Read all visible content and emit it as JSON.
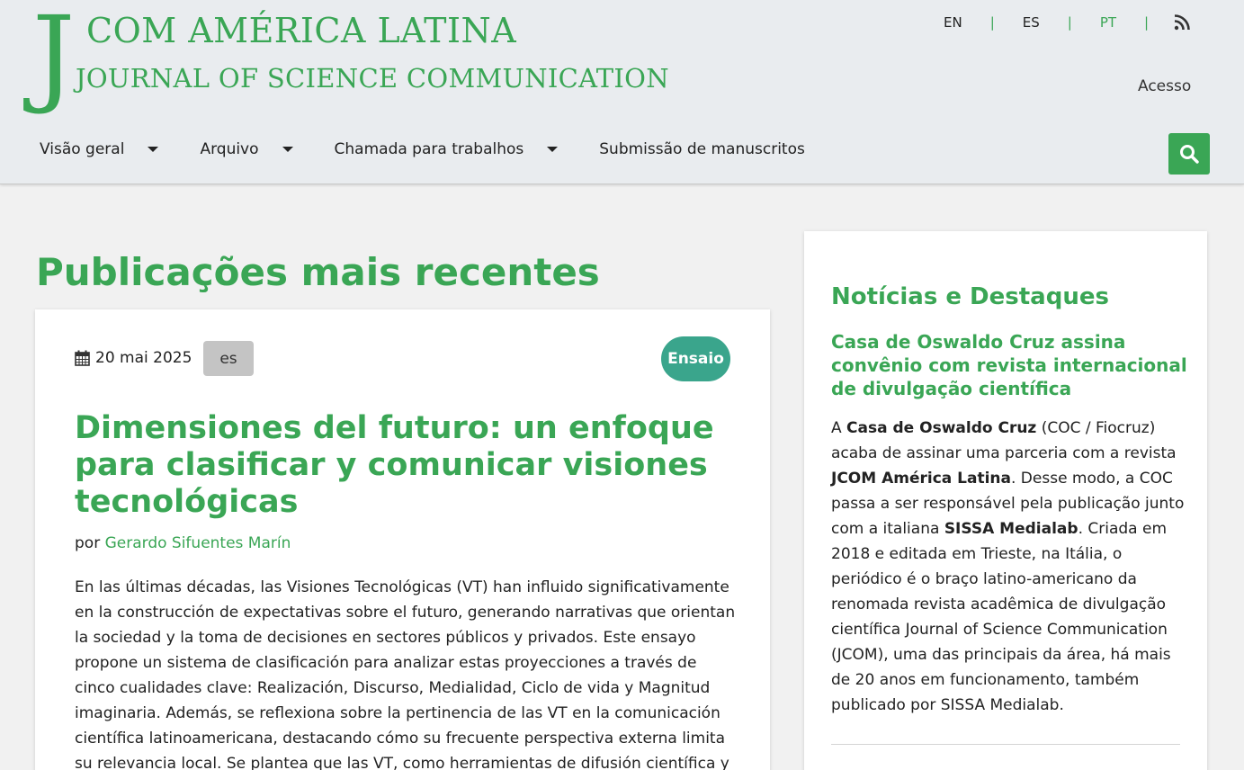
{
  "header": {
    "logo_j": "J",
    "logo_line1": "COM AMÉRICA LATINA",
    "logo_line2": "JOURNAL OF SCIENCE COMMUNICATION",
    "languages": [
      "EN",
      "ES",
      "PT"
    ],
    "active_language": "PT",
    "separator": "|",
    "rss_icon": "rss-icon",
    "login_label": "Acesso",
    "nav": [
      {
        "label": "Visão geral",
        "has_dropdown": true
      },
      {
        "label": "Arquivo",
        "has_dropdown": true
      },
      {
        "label": "Chamada para trabalhos",
        "has_dropdown": true
      },
      {
        "label": "Submissão de manuscritos",
        "has_dropdown": false
      }
    ],
    "search_icon": "search-icon"
  },
  "main": {
    "title": "Publicações mais recentes",
    "article": {
      "date": "20 mai 2025",
      "language": "es",
      "type": "Ensaio",
      "title": "Dimensiones del futuro: un enfoque para clasificar y comunicar visiones tecnológicas",
      "by_label": "por",
      "author": "Gerardo Sifuentes Marín",
      "abstract": "En las últimas décadas, las Visiones Tecnológicas (VT) han influido significativamente en la construcción de expectativas sobre el futuro, generando narrativas que orientan la sociedad y la toma de decisiones en sectores públicos y privados. Este ensayo propone un sistema de clasificación para analizar estas proyecciones a través de cinco cualidades clave: Realización, Discurso, Medialidad, Ciclo de vida y Magnitud imaginaria. Además, se reflexiona sobre la pertinencia de las VT en la comunicación científica latinoamericana, destacando cómo su frecuente perspectiva externa limita su relevancia local. Se plantea que las VT, como herramientas de difusión científica y tecnológica,"
    }
  },
  "sidebar": {
    "heading": "Notícias e Destaques",
    "news_title": "Casa de Oswaldo Cruz assina convênio com revista internacional de divulgação científica",
    "text": {
      "p1": "A ",
      "b1": "Casa de Oswaldo Cruz",
      "p2": " (COC / Fiocruz) acaba de assinar uma parceria com a revista ",
      "b2": "JCOM América Latina",
      "p3": ". Desse modo, a COC passa a ser responsável pela publicação junto com a italiana ",
      "b3": "SISSA Medialab",
      "p4": ". Criada em 2018 e editada em Trieste, na Itália, o periódico é o braço latino-americano da renomada revista acadêmica de divulgação científica Journal of Science Communication (JCOM), uma das principais da área, há mais de 20 anos em funcionamento, também publicado por SISSA Medialab."
    }
  },
  "colors": {
    "brand_green": "#3aa655",
    "badge_teal": "#3aa58c",
    "header_bg": "#e9ecef",
    "page_bg": "#f1f1f1"
  }
}
